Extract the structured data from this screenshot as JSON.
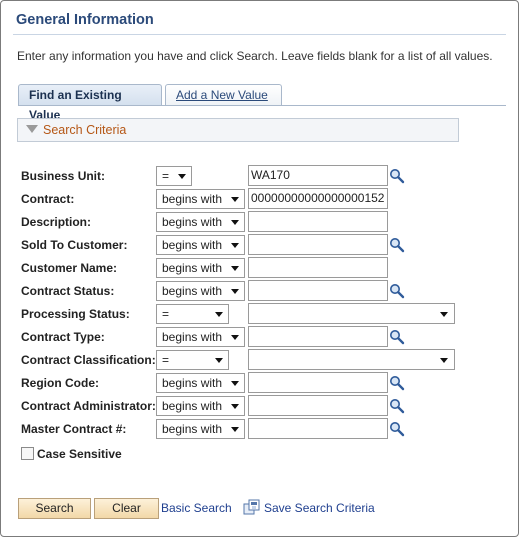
{
  "page": {
    "title": "General Information",
    "instructions": "Enter any information you have and click Search. Leave fields blank for a list of all values."
  },
  "tabs": [
    {
      "label": "Find an Existing Value",
      "active": true
    },
    {
      "label": "Add a New Value",
      "active": false
    }
  ],
  "search_criteria": {
    "header": "Search Criteria",
    "fields": [
      {
        "label": "Business Unit:",
        "operator": "=",
        "value": "WA170",
        "lookup": true,
        "input": "text"
      },
      {
        "label": "Contract:",
        "operator": "begins with",
        "value": "00000000000000000152",
        "lookup": false,
        "input": "text"
      },
      {
        "label": "Description:",
        "operator": "begins with",
        "value": "",
        "lookup": false,
        "input": "text"
      },
      {
        "label": "Sold To Customer:",
        "operator": "begins with",
        "value": "",
        "lookup": true,
        "input": "text"
      },
      {
        "label": "Customer Name:",
        "operator": "begins with",
        "value": "",
        "lookup": false,
        "input": "text"
      },
      {
        "label": "Contract Status:",
        "operator": "begins with",
        "value": "",
        "lookup": true,
        "input": "text"
      },
      {
        "label": "Processing Status:",
        "operator": "=",
        "value": "",
        "lookup": false,
        "input": "dropdown"
      },
      {
        "label": "Contract Type:",
        "operator": "begins with",
        "value": "",
        "lookup": true,
        "input": "text"
      },
      {
        "label": "Contract Classification:",
        "operator": "=",
        "value": "",
        "lookup": false,
        "input": "dropdown"
      },
      {
        "label": "Region Code:",
        "operator": "begins with",
        "value": "",
        "lookup": true,
        "input": "text"
      },
      {
        "label": "Contract Administrator:",
        "operator": "begins with",
        "value": "",
        "lookup": true,
        "input": "text"
      },
      {
        "label": "Master Contract #:",
        "operator": "begins with",
        "value": "",
        "lookup": true,
        "input": "text"
      }
    ],
    "case_sensitive_label": "Case Sensitive",
    "case_sensitive_checked": false
  },
  "actions": {
    "search_label": "Search",
    "clear_label": "Clear",
    "basic_search_label": "Basic Search",
    "save_search_label": "Save Search Criteria"
  },
  "icons": {
    "lookup": "magnifier-icon",
    "save": "save-search-icon"
  },
  "colors": {
    "title": "#2b4a7a",
    "section_label": "#b55716",
    "link": "#1f3f8f",
    "button_bg": "#f2d8a8"
  }
}
